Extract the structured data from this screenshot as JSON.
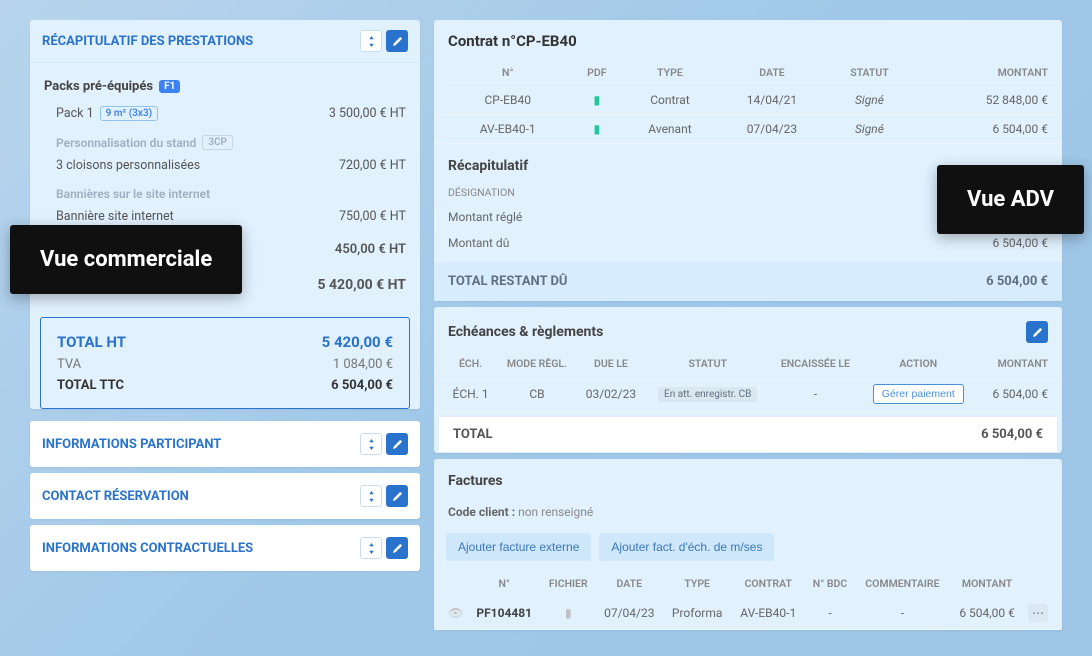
{
  "overlays": {
    "left": "Vue commerciale",
    "right": "Vue ADV"
  },
  "recap": {
    "title": "RÉCAPITULATIF DES PRESTATIONS",
    "packs_title": "Packs pré-équipés",
    "packs_badge": "F1",
    "pack1_label": "Pack 1",
    "pack1_badge": "9 m² (3x3)",
    "pack1_amount": "3 500,00 € HT",
    "perso_title": "Personnalisation du stand",
    "perso_badge": "3CP",
    "perso_line_label": "3 cloisons personnalisées",
    "perso_line_amount": "720,00 € HT",
    "ban_title": "Bannières sur le site internet",
    "ban_line_label": "Bannière site internet",
    "ban_line_amount": "750,00 € HT",
    "extra_amount": "450,00 € HT",
    "subtotal_amount": "5 420,00 € HT",
    "totals": {
      "ht_label": "TOTAL HT",
      "ht_value": "5 420,00 €",
      "tva_label": "TVA",
      "tva_value": "1 084,00 €",
      "ttc_label": "TOTAL TTC",
      "ttc_value": "6 504,00 €"
    }
  },
  "collapsibles": {
    "participant": "INFORMATIONS PARTICIPANT",
    "contact": "CONTACT RÉSERVATION",
    "contractual": "INFORMATIONS CONTRACTUELLES"
  },
  "contract": {
    "title": "Contrat n°CP-EB40",
    "cols": {
      "num": "N°",
      "pdf": "PDF",
      "type": "TYPE",
      "date": "DATE",
      "statut": "STATUT",
      "montant": "MONTANT"
    },
    "rows": [
      {
        "num": "CP-EB40",
        "type": "Contrat",
        "date": "14/04/21",
        "statut": "Signé",
        "montant": "52 848,00 €"
      },
      {
        "num": "AV-EB40-1",
        "type": "Avenant",
        "date": "07/04/23",
        "statut": "Signé",
        "montant": "6 504,00 €"
      }
    ],
    "recap_title": "Récapitulatif",
    "recap_designation": "DÉSIGNATION",
    "recap_rows": [
      {
        "label": "Montant réglé",
        "value": ""
      },
      {
        "label": "Montant dû",
        "value": "6 504,00 €"
      }
    ],
    "total_rest_label": "TOTAL RESTANT DÛ",
    "total_rest_value": "6 504,00 €"
  },
  "sched": {
    "title": "Echéances & règlements",
    "cols": {
      "ech": "ÉCH.",
      "mode": "MODE RÈGL.",
      "due": "DUE LE",
      "statut": "STATUT",
      "encaissee": "ENCAISSÉE LE",
      "action": "ACTION",
      "montant": "MONTANT"
    },
    "row": {
      "ech": "ÉCH. 1",
      "mode": "CB",
      "due": "03/02/23",
      "statut": "En att. enregistr. CB",
      "encaissee": "-",
      "action": "Gérer paiement",
      "montant": "6 504,00 €"
    },
    "total_label": "TOTAL",
    "total_value": "6 504,00 €"
  },
  "invoices": {
    "title": "Factures",
    "code_client_label": "Code client :",
    "code_client_value": "non renseigné",
    "btn_add_external": "Ajouter facture externe",
    "btn_add_sched": "Ajouter fact. d'éch. de m/ses",
    "cols": {
      "num": "N°",
      "fichier": "FICHIER",
      "date": "DATE",
      "type": "TYPE",
      "contrat": "CONTRAT",
      "bdc": "N° BDC",
      "comment": "COMMENTAIRE",
      "montant": "MONTANT"
    },
    "row": {
      "num": "PF104481",
      "date": "07/04/23",
      "type": "Proforma",
      "contrat": "AV-EB40-1",
      "bdc": "-",
      "comment": "-",
      "montant": "6 504,00 €"
    }
  }
}
